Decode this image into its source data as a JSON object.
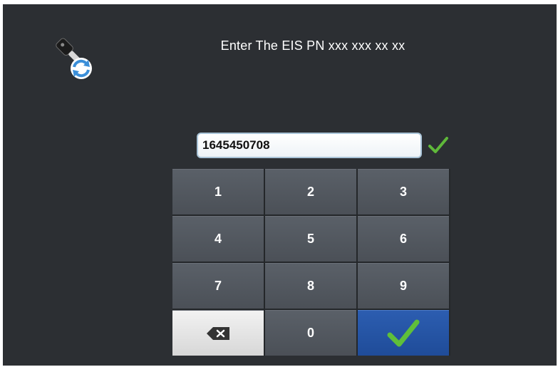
{
  "prompt": {
    "title": "Enter The EIS PN xxx xxx xx xx"
  },
  "input": {
    "value": "1645450708",
    "valid_icon": "check-icon",
    "valid_color": "#5fb83a"
  },
  "keypad": {
    "keys": [
      "1",
      "2",
      "3",
      "4",
      "5",
      "6",
      "7",
      "8",
      "9"
    ],
    "zero": "0",
    "backspace_icon": "backspace-icon",
    "ok_icon": "check-icon",
    "ok_color": "#2c5db0",
    "ok_check_color": "#5fbf3a"
  },
  "header": {
    "icon": "key-sync-icon"
  }
}
